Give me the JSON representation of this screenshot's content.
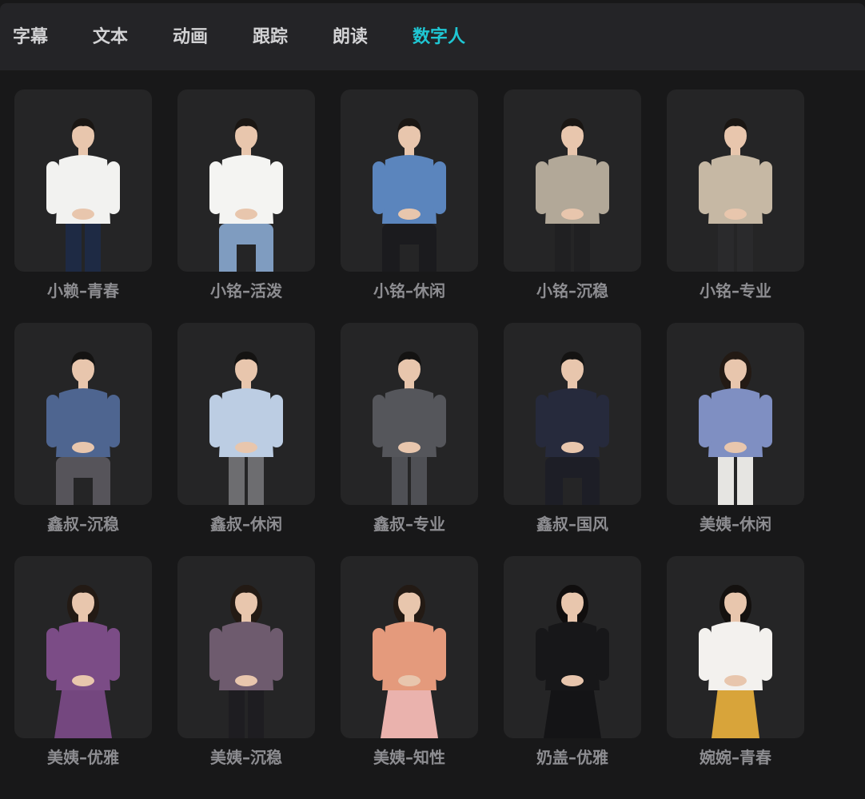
{
  "tabs": [
    {
      "label": "字幕",
      "active": false
    },
    {
      "label": "文本",
      "active": false
    },
    {
      "label": "动画",
      "active": false
    },
    {
      "label": "跟踪",
      "active": false
    },
    {
      "label": "朗读",
      "active": false
    },
    {
      "label": "数字人",
      "active": true
    }
  ],
  "colors": {
    "accent": "#1fc7d4",
    "background": "#181819",
    "tabbar": "#242427",
    "card": "#252526",
    "caption": "#8d8d91"
  },
  "avatars": [
    {
      "name": "小赖–青春",
      "hair": "#1a1613",
      "top": "#f2f2f0",
      "bottom": "#1e2a44",
      "gender": "m",
      "pose": "stand"
    },
    {
      "name": "小铭–活泼",
      "hair": "#1a1613",
      "top": "#f4f4f2",
      "bottom": "#7f9cc0",
      "gender": "m",
      "pose": "sit"
    },
    {
      "name": "小铭–休闲",
      "hair": "#1a1613",
      "top": "#5b85bd",
      "bottom": "#1b1b1e",
      "gender": "m",
      "pose": "sit"
    },
    {
      "name": "小铭–沉稳",
      "hair": "#1a1613",
      "top": "#b2a898",
      "bottom": "#202022",
      "gender": "m",
      "pose": "stand"
    },
    {
      "name": "小铭–专业",
      "hair": "#1a1613",
      "top": "#c6b8a4",
      "bottom": "#2a2a2c",
      "gender": "m",
      "pose": "stand"
    },
    {
      "name": "鑫叔–沉稳",
      "hair": "#141312",
      "top": "#4e6590",
      "bottom": "#56545a",
      "gender": "m",
      "pose": "sit"
    },
    {
      "name": "鑫叔–休闲",
      "hair": "#141312",
      "top": "#bccde3",
      "bottom": "#6d6d70",
      "gender": "m",
      "pose": "stand"
    },
    {
      "name": "鑫叔–专业",
      "hair": "#141312",
      "top": "#55565b",
      "bottom": "#4f5055",
      "gender": "m",
      "pose": "stand"
    },
    {
      "name": "鑫叔–国风",
      "hair": "#141312",
      "top": "#262a3c",
      "bottom": "#1d1e26",
      "gender": "m",
      "pose": "sit"
    },
    {
      "name": "美姨–休闲",
      "hair": "#231a14",
      "top": "#7f8fc2",
      "bottom": "#e6e5e2",
      "gender": "f",
      "pose": "stand"
    },
    {
      "name": "美姨–优雅",
      "hair": "#231a14",
      "top": "#7b4c86",
      "bottom": "#74477f",
      "gender": "f",
      "pose": "dress"
    },
    {
      "name": "美姨–沉稳",
      "hair": "#231a14",
      "top": "#6e5b6e",
      "bottom": "#1e1d21",
      "gender": "f",
      "pose": "stand"
    },
    {
      "name": "美姨–知性",
      "hair": "#231a14",
      "top": "#e49a7c",
      "bottom": "#eab2ad",
      "gender": "f",
      "pose": "dress"
    },
    {
      "name": "奶盖–优雅",
      "hair": "#100e0e",
      "top": "#171719",
      "bottom": "#141416",
      "gender": "f",
      "pose": "dress"
    },
    {
      "name": "婉婉–青春",
      "hair": "#14110f",
      "top": "#f3f1ee",
      "bottom": "#d8a43a",
      "gender": "f",
      "pose": "skirt"
    }
  ]
}
